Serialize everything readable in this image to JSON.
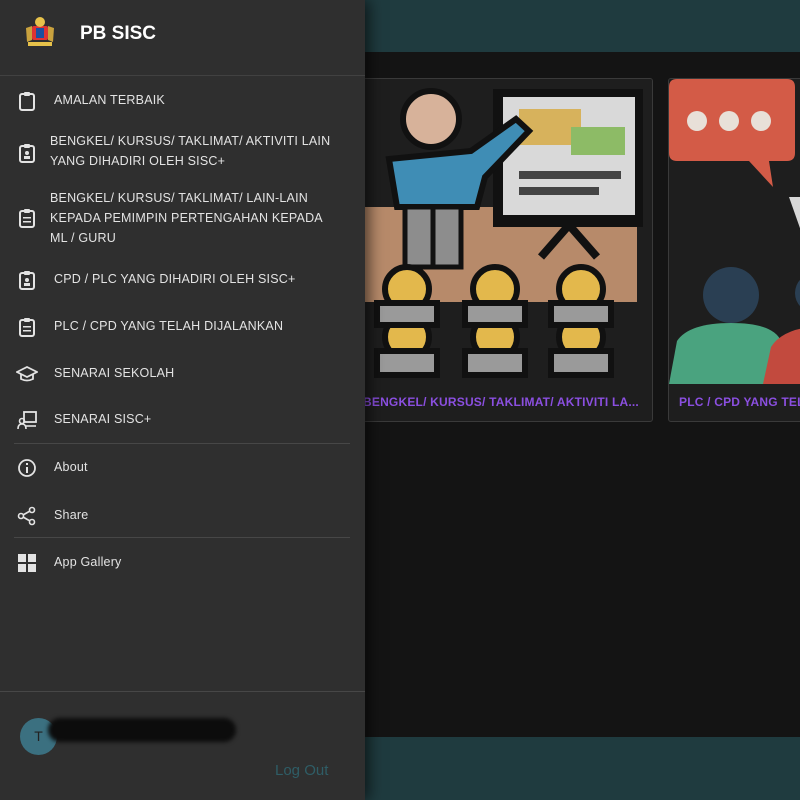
{
  "app": {
    "title": "PB SISC",
    "colors": {
      "header": "#1f3b3f",
      "drawer": "#2f2f2f",
      "card_title": "#8b4fe0",
      "logout": "#2f5d66"
    }
  },
  "drawer": {
    "menu": [
      {
        "label": "AMALAN TERBAIK",
        "icon": "clipboard-icon"
      },
      {
        "label": "BENGKEL/ KURSUS/ TAKLIMAT/ AKTIVITI LAIN YANG DIHADIRI OLEH SISC+",
        "icon": "clipboard-person-icon"
      },
      {
        "label": "BENGKEL/ KURSUS/ TAKLIMAT/ LAIN-LAIN KEPADA PEMIMPIN PERTENGAHAN KEPADA ML / GURU",
        "icon": "clipboard-list-icon"
      },
      {
        "label": "CPD / PLC YANG DIHADIRI OLEH SISC+",
        "icon": "clipboard-person-icon"
      },
      {
        "label": "PLC / CPD YANG TELAH DIJALANKAN",
        "icon": "clipboard-list-icon"
      },
      {
        "label": "SENARAI SEKOLAH",
        "icon": "graduation-cap-icon"
      },
      {
        "label": "SENARAI SISC+",
        "icon": "person-board-icon"
      }
    ],
    "secondary": [
      {
        "label": "About",
        "icon": "info-icon"
      },
      {
        "label": "Share",
        "icon": "share-icon"
      }
    ],
    "extra": [
      {
        "label": "App Gallery",
        "icon": "grid-icon"
      }
    ],
    "user": {
      "initial": "T"
    },
    "logout_label": "Log Out"
  },
  "cards": [
    {
      "title": "BENGKEL/ KURSUS/ TAKLIMAT/ AKTIVITI LA...",
      "image": "presentation-illustration"
    },
    {
      "title": "PLC / CPD YANG TEL",
      "image": "discussion-illustration"
    }
  ]
}
